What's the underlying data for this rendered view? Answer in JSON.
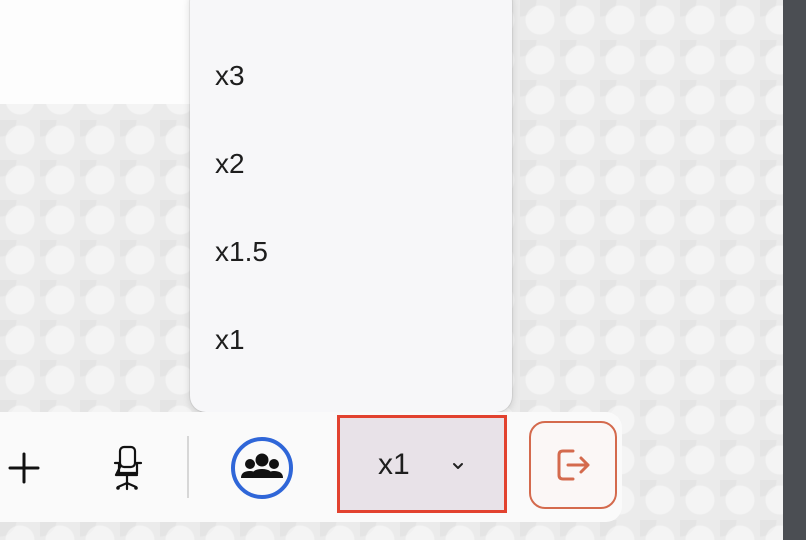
{
  "speed_menu": {
    "options": [
      {
        "label": "x3"
      },
      {
        "label": "x2"
      },
      {
        "label": "x1.5"
      },
      {
        "label": "x1"
      }
    ]
  },
  "toolbar": {
    "speed_select": {
      "value": "x1"
    },
    "icons": {
      "add": "plus-icon",
      "seat": "office-chair-icon",
      "participants": "users-group-icon",
      "exit": "exit-arrow-icon",
      "dropdown": "chevron-down-icon"
    }
  },
  "colors": {
    "highlight_border": "#e2422f",
    "selected_background": "#e8e2e8",
    "participants_ring": "#2f66d8",
    "exit_accent": "#d46a4d",
    "menu_background": "#f7f7f9",
    "toolbar_background": "#fafafa"
  }
}
